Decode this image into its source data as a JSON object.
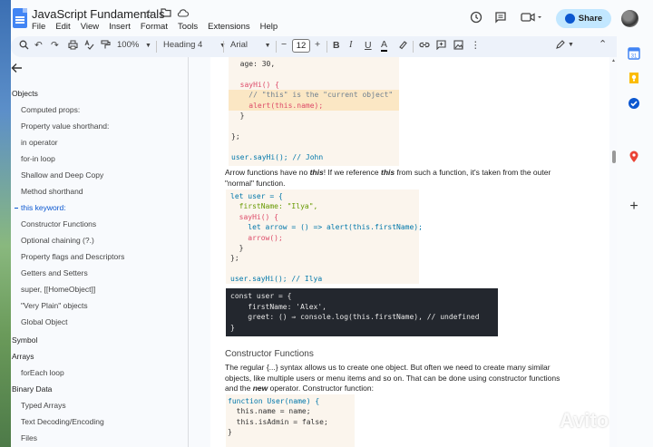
{
  "app": {
    "doc_title": "JavaScript Fundamentals",
    "menu": [
      "File",
      "Edit",
      "View",
      "Insert",
      "Format",
      "Tools",
      "Extensions",
      "Help"
    ],
    "share_label": "Share"
  },
  "toolbar": {
    "zoom": "100%",
    "paragraph_style": "Heading 4",
    "font": "Arial",
    "font_size": "12"
  },
  "outline": {
    "items": [
      {
        "label": "Objects",
        "level": 2
      },
      {
        "label": "Computed props:",
        "level": 3
      },
      {
        "label": "Property value shorthand:",
        "level": 3
      },
      {
        "label": "in operator",
        "level": 3
      },
      {
        "label": "for-in loop",
        "level": 3
      },
      {
        "label": "Shallow and Deep Copy",
        "level": 3
      },
      {
        "label": "Method shorthand",
        "level": 3
      },
      {
        "label": "this keyword:",
        "level": 3,
        "active": true
      },
      {
        "label": "Constructor Functions",
        "level": 3
      },
      {
        "label": "Optional chaining (?.)",
        "level": 3
      },
      {
        "label": "Property flags and Descriptors",
        "level": 3
      },
      {
        "label": "Getters and Setters",
        "level": 3
      },
      {
        "label": "super, [[HomeObject]]",
        "level": 3
      },
      {
        "label": "\"Very Plain\" objects",
        "level": 3
      },
      {
        "label": "Global Object",
        "level": 3
      },
      {
        "label": "Symbol",
        "level": 2
      },
      {
        "label": "Arrays",
        "level": 2
      },
      {
        "label": "forEach loop",
        "level": 3
      },
      {
        "label": "Binary Data",
        "level": 2
      },
      {
        "label": "Typed Arrays",
        "level": 3
      },
      {
        "label": "Text Decoding/Encoding",
        "level": 3
      },
      {
        "label": "Files",
        "level": 3
      }
    ]
  },
  "document": {
    "code1": {
      "line1": "  age: 30,",
      "line2": "  sayHi() {",
      "line3": "    // \"this\" is the \"current object\"",
      "line4": "    alert(this.name);",
      "line5": "  }",
      "line6": "};",
      "line7": "user.sayHi(); // John"
    },
    "para1": {
      "a": "Arrow functions have no ",
      "b": "this",
      "c": "! If we reference ",
      "d": "this",
      "e": " from such a function, it's taken from the outer",
      "f": "\"normal\" function."
    },
    "code2": {
      "line1": "let user = {",
      "line2": "  firstName: \"Ilya\",",
      "line3": "  sayHi() {",
      "line4": "    let arrow = () => alert(this.firstName);",
      "line5": "    arrow();",
      "line6": "  }",
      "line7": "};",
      "line8": "user.sayHi(); // Ilya"
    },
    "code3": {
      "line1": "const user = {",
      "line2": "    firstName: 'Alex',",
      "line3": "    greet: () ⇒ console.log(this.firstName), // undefined",
      "line4": "}"
    },
    "heading": "Constructor Functions",
    "para2": {
      "line1": "The regular {...} syntax allows us to create one object. But often we need to create many similar",
      "line2": "objects, like multiple users or menu items and so on. That can be done using constructor functions",
      "line3a": "and the ",
      "line3b": "new",
      "line3c": " operator. Constructor function:"
    },
    "code4": {
      "line1": "function User(name) {",
      "line2": "  this.name = name;",
      "line3": "  this.isAdmin = false;",
      "line4": "}"
    }
  },
  "watermark": "Avito",
  "icons": [
    "docs-logo-icon",
    "star-icon",
    "folder-icon",
    "cloud-icon",
    "history-icon",
    "comment-icon",
    "video-call-icon",
    "globe-icon",
    "back-arrow-icon",
    "keep-icon",
    "tasks-icon",
    "maps-icon",
    "plus-icon"
  ]
}
